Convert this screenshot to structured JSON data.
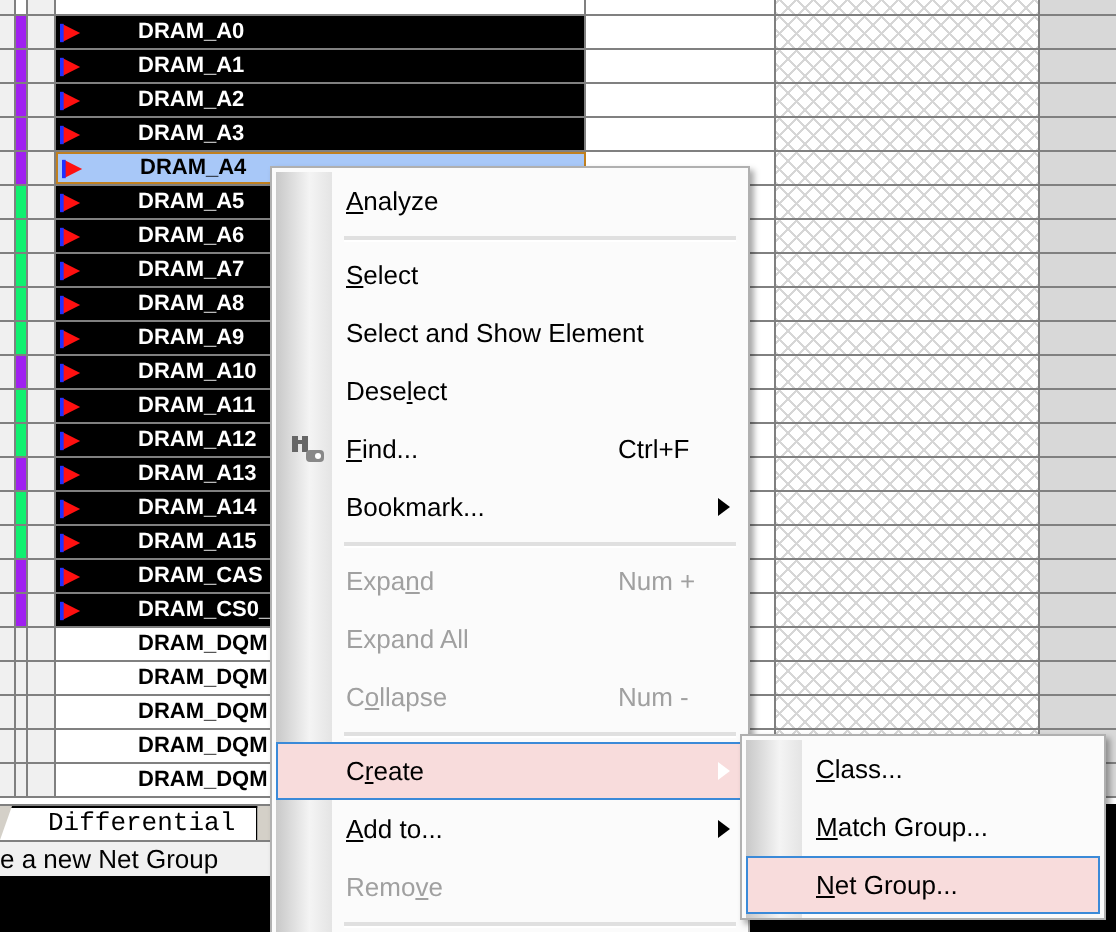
{
  "nets": [
    {
      "name": "DRAM_A0",
      "color": "#a020f0",
      "selected": true,
      "current": false
    },
    {
      "name": "DRAM_A1",
      "color": "#a020f0",
      "selected": true,
      "current": false
    },
    {
      "name": "DRAM_A2",
      "color": "#a020f0",
      "selected": true,
      "current": false
    },
    {
      "name": "DRAM_A3",
      "color": "#a020f0",
      "selected": true,
      "current": false
    },
    {
      "name": "DRAM_A4",
      "color": "#a020f0",
      "selected": true,
      "current": true
    },
    {
      "name": "DRAM_A5",
      "color": "#10f070",
      "selected": true,
      "current": false
    },
    {
      "name": "DRAM_A6",
      "color": "#10f070",
      "selected": true,
      "current": false
    },
    {
      "name": "DRAM_A7",
      "color": "#10f070",
      "selected": true,
      "current": false
    },
    {
      "name": "DRAM_A8",
      "color": "#10f070",
      "selected": true,
      "current": false
    },
    {
      "name": "DRAM_A9",
      "color": "#10f070",
      "selected": true,
      "current": false
    },
    {
      "name": "DRAM_A10",
      "color": "#a020f0",
      "selected": true,
      "current": false
    },
    {
      "name": "DRAM_A11",
      "color": "#10f070",
      "selected": true,
      "current": false
    },
    {
      "name": "DRAM_A12",
      "color": "#10f070",
      "selected": true,
      "current": false
    },
    {
      "name": "DRAM_A13",
      "color": "#a020f0",
      "selected": true,
      "current": false
    },
    {
      "name": "DRAM_A14",
      "color": "#10f070",
      "selected": true,
      "current": false
    },
    {
      "name": "DRAM_A15",
      "color": "#10f070",
      "selected": true,
      "current": false
    },
    {
      "name": "DRAM_CAS",
      "color": "#a020f0",
      "selected": true,
      "current": false
    },
    {
      "name": "DRAM_CS0_",
      "color": "#a020f0",
      "selected": true,
      "current": false
    },
    {
      "name": "DRAM_DQM",
      "selected": false,
      "current": false
    },
    {
      "name": "DRAM_DQM",
      "selected": false,
      "current": false
    },
    {
      "name": "DRAM_DQM",
      "selected": false,
      "current": false
    },
    {
      "name": "DRAM_DQM",
      "selected": false,
      "current": false
    },
    {
      "name": "DRAM_DQM",
      "selected": false,
      "current": false
    }
  ],
  "bottom_tab": {
    "label": "Differential"
  },
  "status_text": "e a new Net Group",
  "context_menu": {
    "items": [
      {
        "kind": "item",
        "mnemonic": "A",
        "text_after": "nalyze",
        "disabled": false,
        "highlighted": false
      },
      {
        "kind": "separator"
      },
      {
        "kind": "item",
        "mnemonic": "S",
        "text_after": "elect",
        "disabled": false,
        "highlighted": false
      },
      {
        "kind": "item",
        "text_before": "Select and Show Element",
        "disabled": false,
        "highlighted": false
      },
      {
        "kind": "item",
        "text_before": "Dese",
        "mnemonic": "l",
        "text_after": "ect",
        "disabled": false,
        "highlighted": false
      },
      {
        "kind": "item",
        "mnemonic": "F",
        "text_after": "ind...",
        "shortcut": "Ctrl+F",
        "icon": true,
        "disabled": false,
        "highlighted": false
      },
      {
        "kind": "item",
        "text_before": "Bookmark...",
        "submenu": true,
        "disabled": false,
        "highlighted": false
      },
      {
        "kind": "separator"
      },
      {
        "kind": "item",
        "text_before": "Expa",
        "mnemonic": "n",
        "text_after": "d",
        "shortcut": "Num +",
        "disabled": true,
        "highlighted": false
      },
      {
        "kind": "item",
        "text_before": "Expand All",
        "disabled": true,
        "highlighted": false
      },
      {
        "kind": "item",
        "text_before": "C",
        "mnemonic": "o",
        "text_after": "llapse",
        "shortcut": "Num -",
        "disabled": true,
        "highlighted": false
      },
      {
        "kind": "separator"
      },
      {
        "kind": "item",
        "text_before": "C",
        "mnemonic": "r",
        "text_after": "eate",
        "submenu": true,
        "disabled": false,
        "highlighted": true
      },
      {
        "kind": "item",
        "mnemonic": "A",
        "text_after": "dd to...",
        "submenu": true,
        "disabled": false,
        "highlighted": false
      },
      {
        "kind": "item",
        "text_before": "Remo",
        "mnemonic": "v",
        "text_after": "e",
        "disabled": true,
        "highlighted": false
      },
      {
        "kind": "separator"
      }
    ]
  },
  "submenu": {
    "items": [
      {
        "kind": "item",
        "mnemonic": "C",
        "text_after": "lass...",
        "disabled": false,
        "highlighted": false
      },
      {
        "kind": "item",
        "mnemonic": "M",
        "text_after": "atch Group...",
        "disabled": false,
        "highlighted": false
      },
      {
        "kind": "item",
        "mnemonic": "N",
        "text_after": "et Group...",
        "disabled": false,
        "highlighted": true
      }
    ]
  }
}
